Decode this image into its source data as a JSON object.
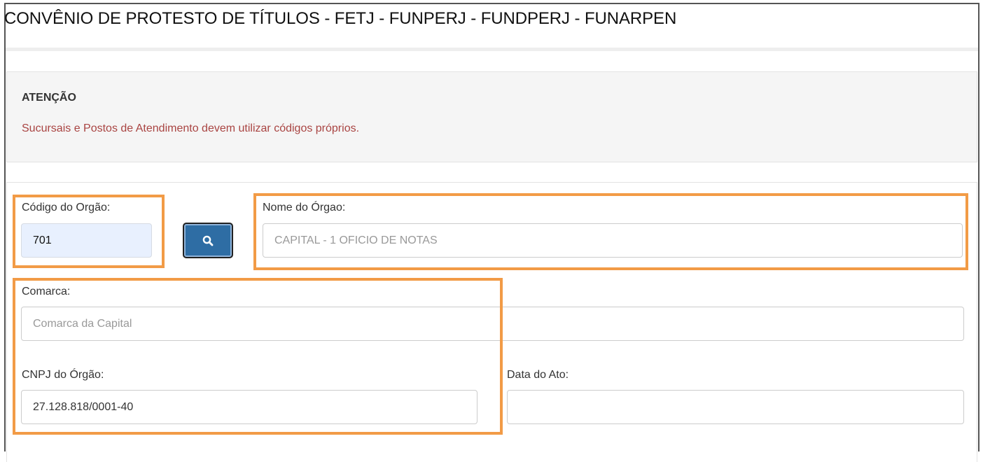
{
  "page": {
    "title": "CONVÊNIO DE PROTESTO DE TÍTULOS - FETJ - FUNPERJ - FUNDPERJ - FUNARPEN"
  },
  "alert": {
    "title": "ATENÇÃO",
    "message": "Sucursais e Postos de Atendimento devem utilizar códigos próprios.",
    "message_color": "#a94442"
  },
  "form": {
    "codigo": {
      "label": "Código do Orgão:",
      "value": "701"
    },
    "search_button": {
      "icon": "search-icon"
    },
    "nome": {
      "label": "Nome do Órgao:",
      "value": "CAPITAL - 1 OFICIO DE NOTAS"
    },
    "comarca": {
      "label": "Comarca:",
      "value": "Comarca da Capital"
    },
    "cnpj": {
      "label": "CNPJ do Órgão:",
      "value": "27.128.818/0001-40"
    },
    "data_ato": {
      "label": "Data do Ato:",
      "value": ""
    }
  },
  "annotation": {
    "highlight_color": "#f29b46"
  },
  "theme": {
    "button_color": "#2e6da4",
    "autofill_color": "#e8f0fe"
  }
}
